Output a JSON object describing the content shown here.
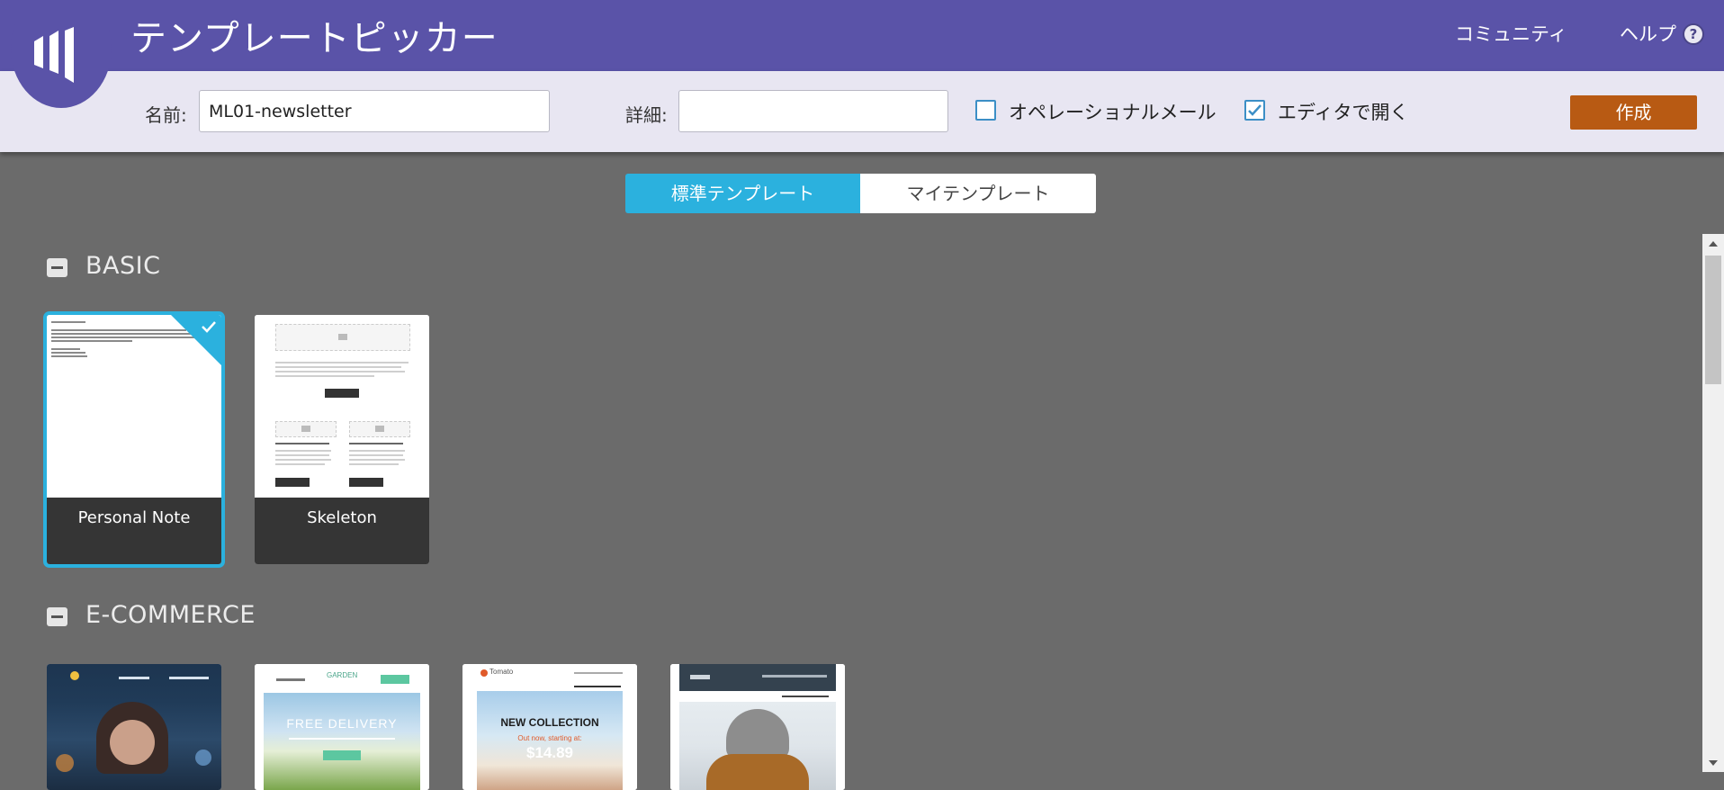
{
  "app": {
    "title": "テンプレートピッカー"
  },
  "topnav": {
    "community": "コミュニティ",
    "help": "ヘルプ",
    "help_icon_glyph": "?"
  },
  "form": {
    "name_label": "名前:",
    "name_value": "ML01-newsletter",
    "detail_label": "詳細:",
    "detail_value": "",
    "operational_label": "オペレーショナルメール",
    "operational_checked": false,
    "open_editor_label": "エディタで開く",
    "open_editor_checked": true,
    "create_label": "作成"
  },
  "tabs": [
    {
      "label": "標準テンプレート",
      "active": true
    },
    {
      "label": "マイテンプレート",
      "active": false
    }
  ],
  "sections": [
    {
      "title": "BASIC",
      "templates": [
        {
          "name": "Personal Note",
          "selected": true
        },
        {
          "name": "Skeleton",
          "selected": false
        }
      ]
    },
    {
      "title": "E-COMMERCE",
      "templates": [
        {
          "name": "",
          "thumb_texts": []
        },
        {
          "name": "",
          "thumb_texts": [
            "GARDEN",
            "FREE DELIVERY"
          ]
        },
        {
          "name": "",
          "thumb_texts": [
            "Tomato",
            "NEW COLLECTION",
            "Out now, starting at:",
            "$14.89"
          ]
        },
        {
          "name": "",
          "thumb_texts": []
        }
      ]
    }
  ],
  "colors": {
    "header": "#5a53a8",
    "form_bg": "#e8e6f2",
    "accent": "#2bb1de",
    "create_button": "#b85a13",
    "workspace": "#6b6b6b"
  },
  "icons": {
    "logo": "marketo-logo-icon",
    "checkmark": "check-icon",
    "collapse": "minus-icon"
  }
}
